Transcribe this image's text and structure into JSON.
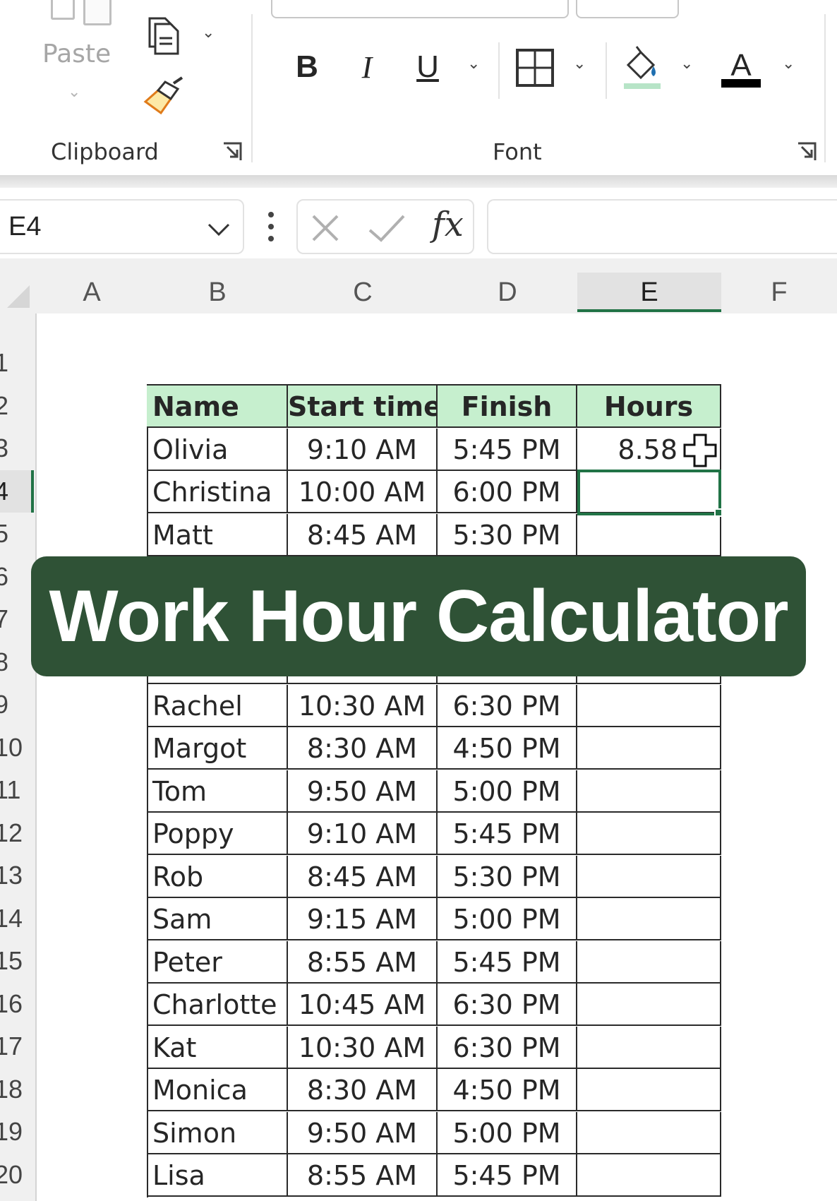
{
  "ribbon": {
    "clipboard": {
      "paste_label": "Paste",
      "group_label": "Clipboard"
    },
    "font": {
      "group_label": "Font",
      "bold": "B",
      "italic": "I",
      "underline": "U",
      "font_color_glyph": "A"
    },
    "icons": [
      "copy-icon",
      "format-painter-icon",
      "borders-icon",
      "fill-color-icon",
      "font-color-icon",
      "dialog-launcher-icon"
    ],
    "colors": {
      "fill_highlight": "#b7e4c7",
      "font_color_bar": "#000000"
    }
  },
  "formula_bar": {
    "name_box": "E4",
    "fx_label": "fx",
    "formula": ""
  },
  "grid": {
    "columns": [
      "A",
      "B",
      "C",
      "D",
      "E",
      "F"
    ],
    "selected_column": "E",
    "rows": [
      "1",
      "2",
      "3",
      "4",
      "5",
      "6",
      "7",
      "8",
      "9",
      "10",
      "11",
      "12",
      "13",
      "14",
      "15",
      "16",
      "17",
      "18",
      "19",
      "20"
    ],
    "selected_row": "4",
    "accent": "#217346",
    "header_fill": "#c6efce"
  },
  "table": {
    "headers": [
      "Name",
      "Start time",
      "Finish",
      "Hours"
    ],
    "rows": [
      {
        "name": "Olivia",
        "start": "9:10 AM",
        "finish": "5:45 PM",
        "hours": "8.58"
      },
      {
        "name": "Christina",
        "start": "10:00 AM",
        "finish": "6:00 PM",
        "hours": ""
      },
      {
        "name": "Matt",
        "start": "8:45 AM",
        "finish": "5:30 PM",
        "hours": ""
      },
      {
        "name": "Rachel",
        "start": "10:30 AM",
        "finish": "6:30 PM",
        "hours": ""
      },
      {
        "name": "Margot",
        "start": "8:30 AM",
        "finish": "4:50 PM",
        "hours": ""
      },
      {
        "name": "Tom",
        "start": "9:50 AM",
        "finish": "5:00 PM",
        "hours": ""
      },
      {
        "name": "Poppy",
        "start": "9:10 AM",
        "finish": "5:45 PM",
        "hours": ""
      },
      {
        "name": "Rob",
        "start": "8:45 AM",
        "finish": "5:30 PM",
        "hours": ""
      },
      {
        "name": "Sam",
        "start": "9:15 AM",
        "finish": "5:00 PM",
        "hours": ""
      },
      {
        "name": "Peter",
        "start": "8:55 AM",
        "finish": "5:45 PM",
        "hours": ""
      },
      {
        "name": "Charlotte",
        "start": "10:45 AM",
        "finish": "6:30 PM",
        "hours": ""
      },
      {
        "name": "Kat",
        "start": "10:30 AM",
        "finish": "6:30 PM",
        "hours": ""
      },
      {
        "name": "Monica",
        "start": "8:30 AM",
        "finish": "4:50 PM",
        "hours": ""
      },
      {
        "name": "Simon",
        "start": "9:50 AM",
        "finish": "5:00 PM",
        "hours": ""
      },
      {
        "name": "Lisa",
        "start": "8:55 AM",
        "finish": "5:45 PM",
        "hours": ""
      }
    ]
  },
  "banner": {
    "title": "Work Hour Calculator",
    "color": "#2f5236"
  }
}
